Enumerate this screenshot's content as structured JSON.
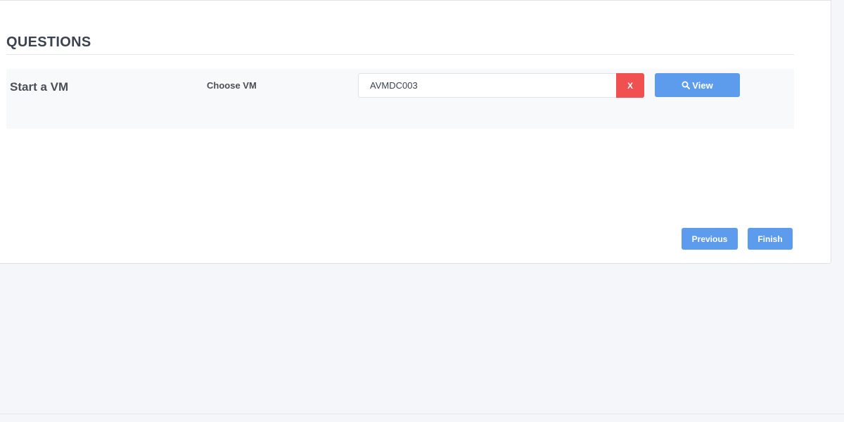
{
  "section": {
    "title": "QUESTIONS"
  },
  "question": {
    "label": "Start a VM",
    "field_label": "Choose VM",
    "vm_value": "AVMDC003",
    "clear_label": "X",
    "view_label": "View",
    "view_icon": "search-icon"
  },
  "navigation": {
    "previous_label": "Previous",
    "finish_label": "Finish"
  },
  "colors": {
    "primary": "#5d9cec",
    "danger": "#f05050",
    "page_background": "#f4f6f9"
  }
}
